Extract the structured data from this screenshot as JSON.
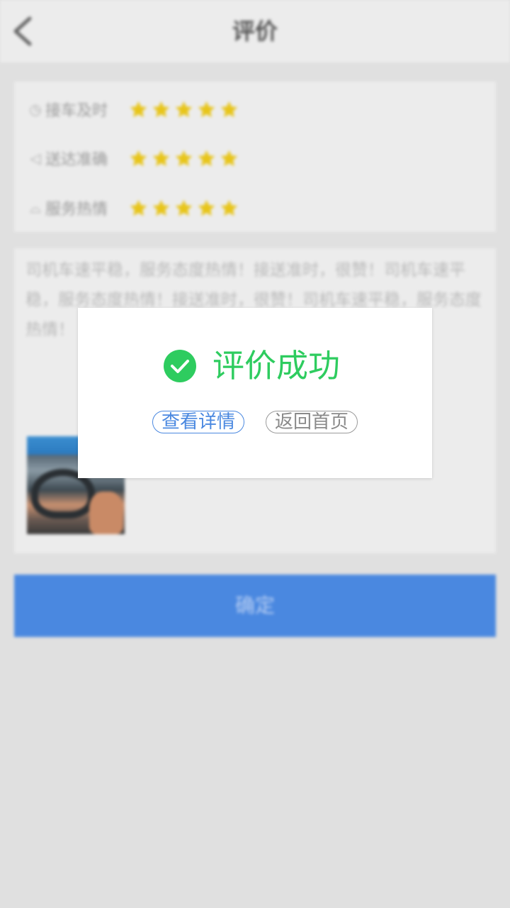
{
  "header": {
    "title": "评价"
  },
  "ratings": [
    {
      "icon": "clock-icon",
      "label": "接车及时",
      "stars": 5
    },
    {
      "icon": "navigation-icon",
      "label": "送达准确",
      "stars": 5
    },
    {
      "icon": "service-bell-icon",
      "label": "服务热情",
      "stars": 5
    }
  ],
  "comment": {
    "text": "司机车速平稳，服务态度热情！接送准时，很赞！司机车速平稳，服务态度热情！接送准时，很赞！司机车速平稳，服务态度热情！"
  },
  "confirm_label": "确定",
  "dialog": {
    "message": "评价成功",
    "view_details_label": "查看详情",
    "back_home_label": "返回首页"
  },
  "colors": {
    "accent_blue": "#4a88e0",
    "success_green": "#2ecc5f",
    "star_yellow": "#e8c51a"
  }
}
